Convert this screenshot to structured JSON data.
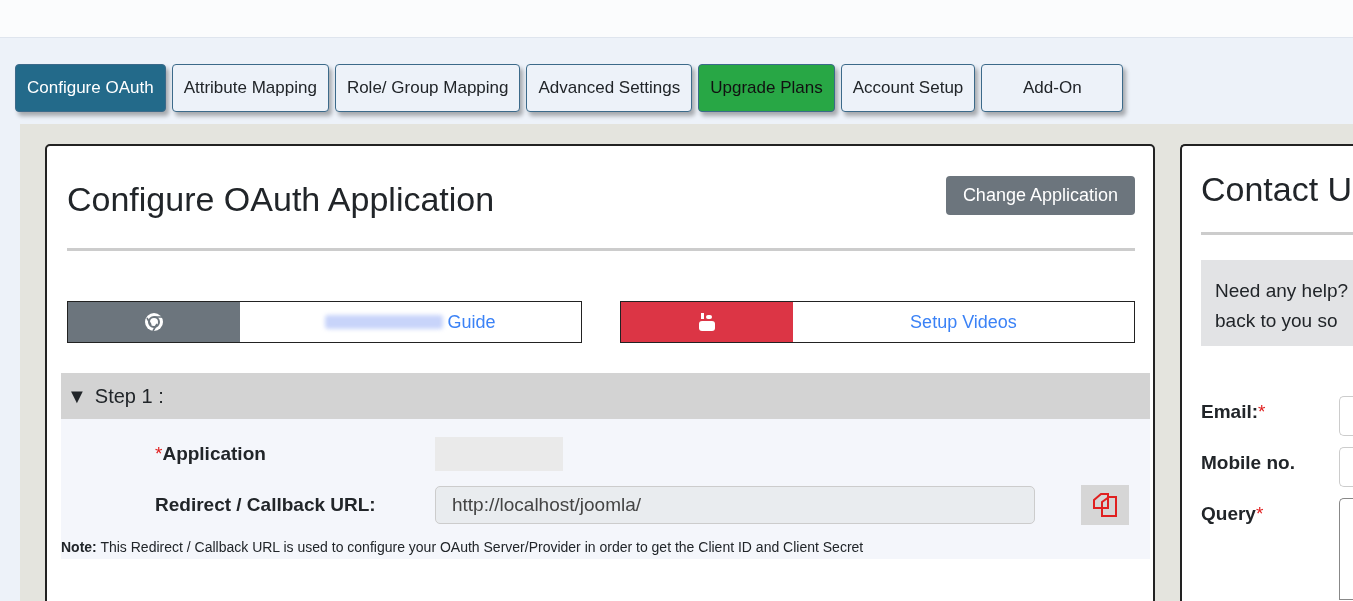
{
  "tabs": [
    {
      "label": "Configure OAuth",
      "selected": true,
      "kind": "normal"
    },
    {
      "label": "Attribute Mapping",
      "selected": false,
      "kind": "normal"
    },
    {
      "label": "Role/ Group Mapping",
      "selected": false,
      "kind": "normal"
    },
    {
      "label": "Advanced Settings",
      "selected": false,
      "kind": "normal"
    },
    {
      "label": "Upgrade Plans",
      "selected": false,
      "kind": "upgrade"
    },
    {
      "label": "Account Setup",
      "selected": false,
      "kind": "normal"
    },
    {
      "label": "Add-On",
      "selected": false,
      "kind": "normal"
    }
  ],
  "config_card": {
    "title": "Configure OAuth Application",
    "change_button": "Change Application",
    "guides": [
      {
        "kind": "docs",
        "link_text": "Guide",
        "redacted_prefix": true
      },
      {
        "kind": "video",
        "link_text": "Setup Videos",
        "redacted_prefix": false
      }
    ],
    "step": {
      "toggle": "▼",
      "label": "Step 1 :",
      "fields": [
        {
          "kind": "redacted",
          "label": "Application",
          "required_mark": "*"
        },
        {
          "kind": "url",
          "label": "Redirect / Callback URL:",
          "value": "http://localhost/joomla/"
        }
      ],
      "note": "**Note:** This Redirect / Callback URL is used to configure your OAuth Server/Provider in order to get the Client ID and Client Secret"
    }
  },
  "contact_card": {
    "title": "Contact U",
    "help_lines": [
      "Need any help?",
      "back to you so"
    ],
    "fields": [
      {
        "kind": "input",
        "label": "Email:",
        "required_mark": "*"
      },
      {
        "kind": "input",
        "label": "Mobile no."
      },
      {
        "kind": "textarea",
        "label": "Query",
        "required_mark": "*"
      }
    ]
  }
}
